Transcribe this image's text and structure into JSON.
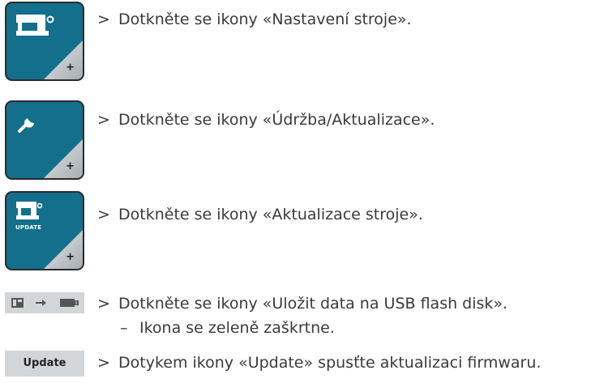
{
  "steps": [
    {
      "marker": ">",
      "text": "Dotkněte se ikony «Nastavení stroje».",
      "icon": "machine-settings-icon"
    },
    {
      "marker": ">",
      "text": "Dotkněte se ikony «Údržba/Aktualizace».",
      "icon": "wrench-icon"
    },
    {
      "marker": ">",
      "text": "Dotkněte se ikony «Aktualizace stroje».",
      "icon": "machine-update-icon",
      "icon_label": "UPDATE"
    },
    {
      "marker": ">",
      "text": "Dotkněte se ikony «Uložit data na USB flash disk».",
      "icon": "save-to-usb-icon",
      "sub": {
        "marker": "–",
        "text": "Ikona se zeleně zaškrtne."
      }
    },
    {
      "marker": ">",
      "text": "Dotykem ikony «Update» spusťte aktualizaci firmwaru.",
      "button_label": "Update"
    }
  ],
  "colors": {
    "tile_blue": "#136f8c",
    "tile_border": "#2b2b2b",
    "text": "#3a3a3a",
    "flat_gray": "#d3d6d8"
  }
}
